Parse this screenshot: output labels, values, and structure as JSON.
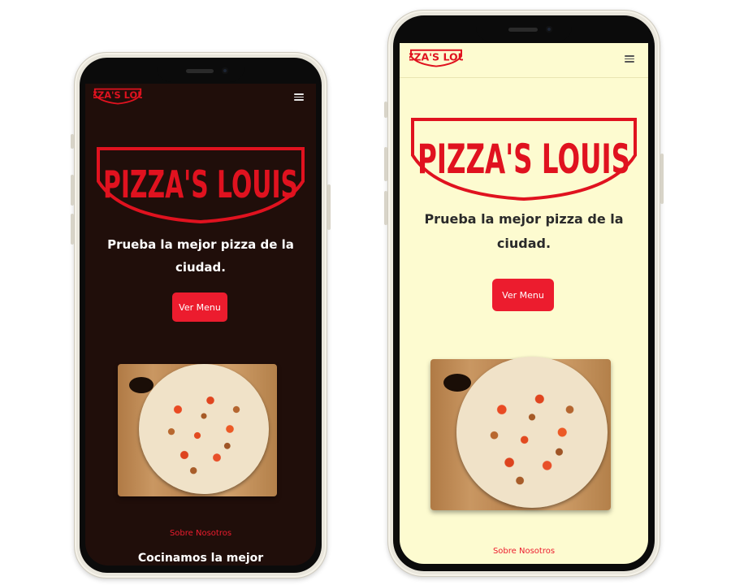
{
  "brand": {
    "name": "PIZZA'S LOUIS",
    "logo_color": "#e0121f"
  },
  "hero": {
    "tagline_line1": "Prueba la mejor pizza de la",
    "tagline_line2": "ciudad.",
    "cta_label": "Ver Menu",
    "cta_color": "#ec1c2e"
  },
  "about": {
    "link_label": "Sobre Nosotros",
    "heading_partial": "Cocinamos la mejor"
  },
  "themes": {
    "dark": {
      "background": "#200e0a",
      "text": "#ffffff"
    },
    "light": {
      "background": "#fdfbd0",
      "text": "#2a2a2a"
    }
  },
  "icons": {
    "menu": "hamburger-icon"
  }
}
